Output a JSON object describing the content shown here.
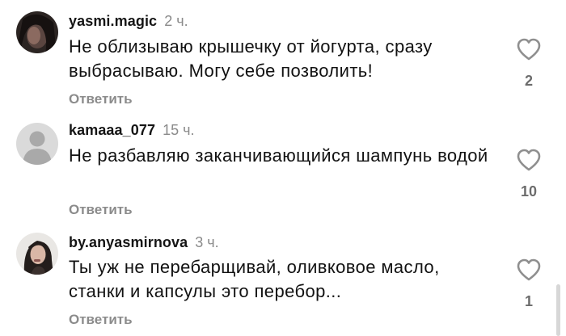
{
  "comments": [
    {
      "username": "yasmi.magic",
      "time": "2 ч.",
      "text": "Не облизываю крышечку от йогурта, сразу выбрасываю. Могу себе позволить!",
      "reply_label": "Ответить",
      "like_count": "2",
      "avatar": "user-photo-avatar"
    },
    {
      "username": "kamaaa_077",
      "time": "15 ч.",
      "text": "Не разбавляю заканчивающийся шампунь водой",
      "reply_label": "Ответить",
      "like_count": "10",
      "avatar": "default-user-avatar"
    },
    {
      "username": "by.anyasmirnova",
      "time": "3 ч.",
      "text": "Ты уж не перебарщивай, оливковое масло, станки и капсулы это перебор...",
      "reply_label": "Ответить",
      "like_count": "1",
      "avatar": "user-photo-avatar"
    }
  ],
  "icons": {
    "like": "heart-outline-icon"
  },
  "colors": {
    "username": "#151515",
    "time": "#8a8a8a",
    "reply": "#8b8b8b",
    "count": "#6c6c6c"
  }
}
